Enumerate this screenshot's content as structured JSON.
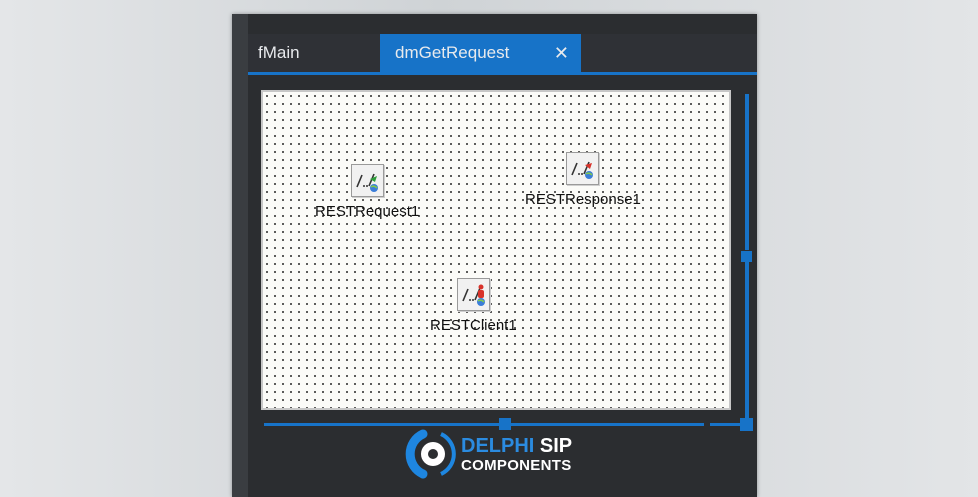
{
  "tabs": {
    "main_label": "fMain",
    "active_label": "dmGetRequest",
    "close_glyph": "✕"
  },
  "components": [
    {
      "label": "RESTRequest1",
      "icon": "rest-request-icon"
    },
    {
      "label": "RESTResponse1",
      "icon": "rest-response-icon"
    },
    {
      "label": "RESTClient1",
      "icon": "rest-client-icon"
    }
  ],
  "logo": {
    "word1": "DELPHI",
    "word2": "SIP",
    "line2": "COMPONENTS",
    "icon": "phone-handset-icon"
  },
  "colors": {
    "accent": "#1773c8",
    "ide_background": "#2b2d30",
    "designer_background": "#fbfbf8"
  }
}
